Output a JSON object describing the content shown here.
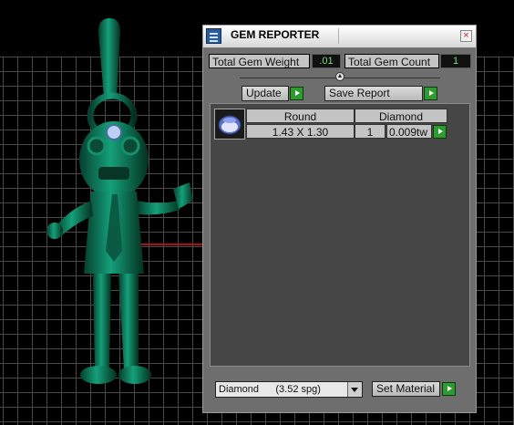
{
  "panel": {
    "title": "GEM REPORTER",
    "close_glyph": "×",
    "total_gem_weight_label": "Total Gem Weight",
    "total_gem_weight_value": ".01",
    "total_gem_count_label": "Total Gem Count",
    "total_gem_count_value": "1",
    "update_label": "Update",
    "save_report_label": "Save Report"
  },
  "gems": {
    "headers": [
      "Round",
      "Diamond"
    ],
    "rows": [
      {
        "size": "1.43 X 1.30",
        "count": "1",
        "weight": "0.009tw"
      }
    ]
  },
  "material": {
    "selected": "Diamond      (3.52 spg)",
    "set_material_label": "Set Material"
  },
  "icons": {
    "app": "report-icon",
    "close": "close-icon",
    "arrow": "play-arrow-icon",
    "gem": "round-gem-icon"
  },
  "colors": {
    "model": "#0e7a5c",
    "value_text": "#7fdc7f",
    "arrow_green": "#2f9a2f"
  }
}
